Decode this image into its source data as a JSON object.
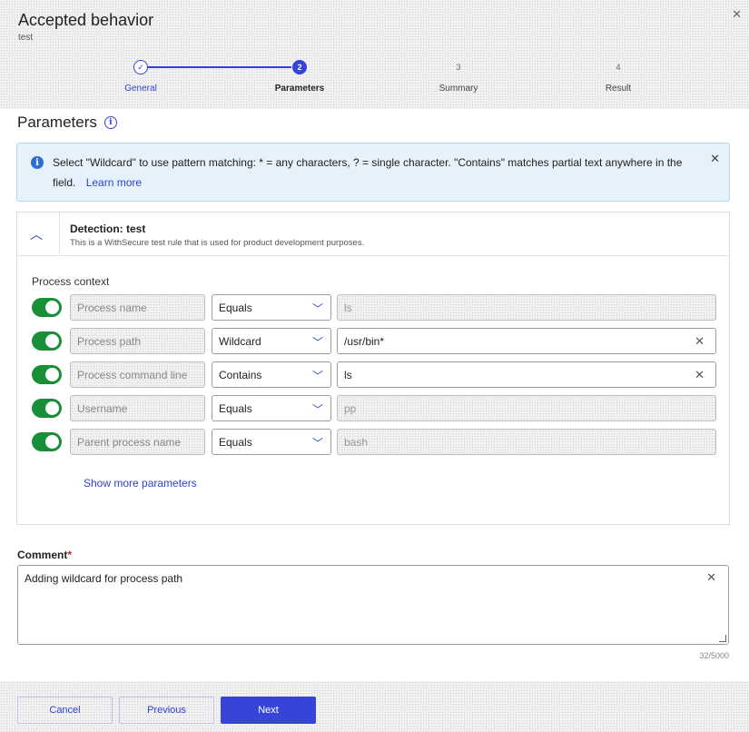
{
  "dialog": {
    "title": "Accepted behavior",
    "subtitle": "test",
    "close_icon": "close-icon"
  },
  "stepper": {
    "steps": [
      {
        "number": "",
        "label": "General",
        "state": "done"
      },
      {
        "number": "2",
        "label": "Parameters",
        "state": "active"
      },
      {
        "number": "3",
        "label": "Summary",
        "state": "future"
      },
      {
        "number": "4",
        "label": "Result",
        "state": "future"
      }
    ]
  },
  "section": {
    "title": "Parameters"
  },
  "banner": {
    "text": "Select \"Wildcard\" to use pattern matching: * = any characters, ? = single character. \"Contains\" matches partial text anywhere in the field.",
    "link": "Learn more"
  },
  "detection": {
    "title": "Detection: test",
    "description": "This is a WithSecure test rule that is used for product development purposes."
  },
  "process_context": {
    "label": "Process context",
    "rows": [
      {
        "name": "Process name",
        "operator": "Equals",
        "value": "ls",
        "enabled": true,
        "editable": false
      },
      {
        "name": "Process path",
        "operator": "Wildcard",
        "value": "/usr/bin*",
        "enabled": true,
        "editable": true
      },
      {
        "name": "Process command line",
        "operator": "Contains",
        "value": "ls",
        "enabled": true,
        "editable": true
      },
      {
        "name": "Username",
        "operator": "Equals",
        "value": "pp",
        "enabled": true,
        "editable": false
      },
      {
        "name": "Parent process name",
        "operator": "Equals",
        "value": "bash",
        "enabled": true,
        "editable": false
      }
    ],
    "show_more": "Show more parameters"
  },
  "comment": {
    "label": "Comment",
    "required_mark": "*",
    "value": "Adding wildcard for process path",
    "counter": "32/5000"
  },
  "footer": {
    "cancel": "Cancel",
    "previous": "Previous",
    "next": "Next"
  },
  "colors": {
    "accent": "#3442d6",
    "toggle_on": "#1a8f3a",
    "banner_bg": "#e5f1fb"
  }
}
